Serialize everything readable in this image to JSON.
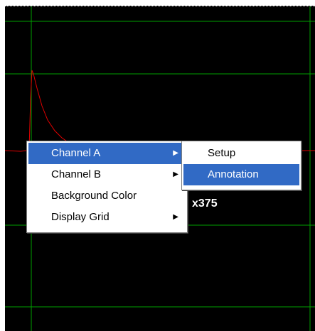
{
  "scope": {
    "colors": {
      "background": "#000000",
      "grid": "#00a000",
      "trace": "#e00000"
    },
    "overlay_text": "x375"
  },
  "context_menu": {
    "items": [
      {
        "label": "Channel A",
        "has_submenu": true,
        "arrow": "▶"
      },
      {
        "label": "Channel B",
        "has_submenu": true,
        "arrow": "▶"
      },
      {
        "label": "Background Color",
        "has_submenu": false
      },
      {
        "label": "Display Grid",
        "has_submenu": true,
        "arrow": "▶"
      }
    ],
    "selected_index": 0,
    "highlight_color": "#316ac5"
  },
  "submenu": {
    "parent": "Channel A",
    "items": [
      {
        "label": "Setup"
      },
      {
        "label": "Annotation"
      }
    ],
    "selected_index": 1
  }
}
